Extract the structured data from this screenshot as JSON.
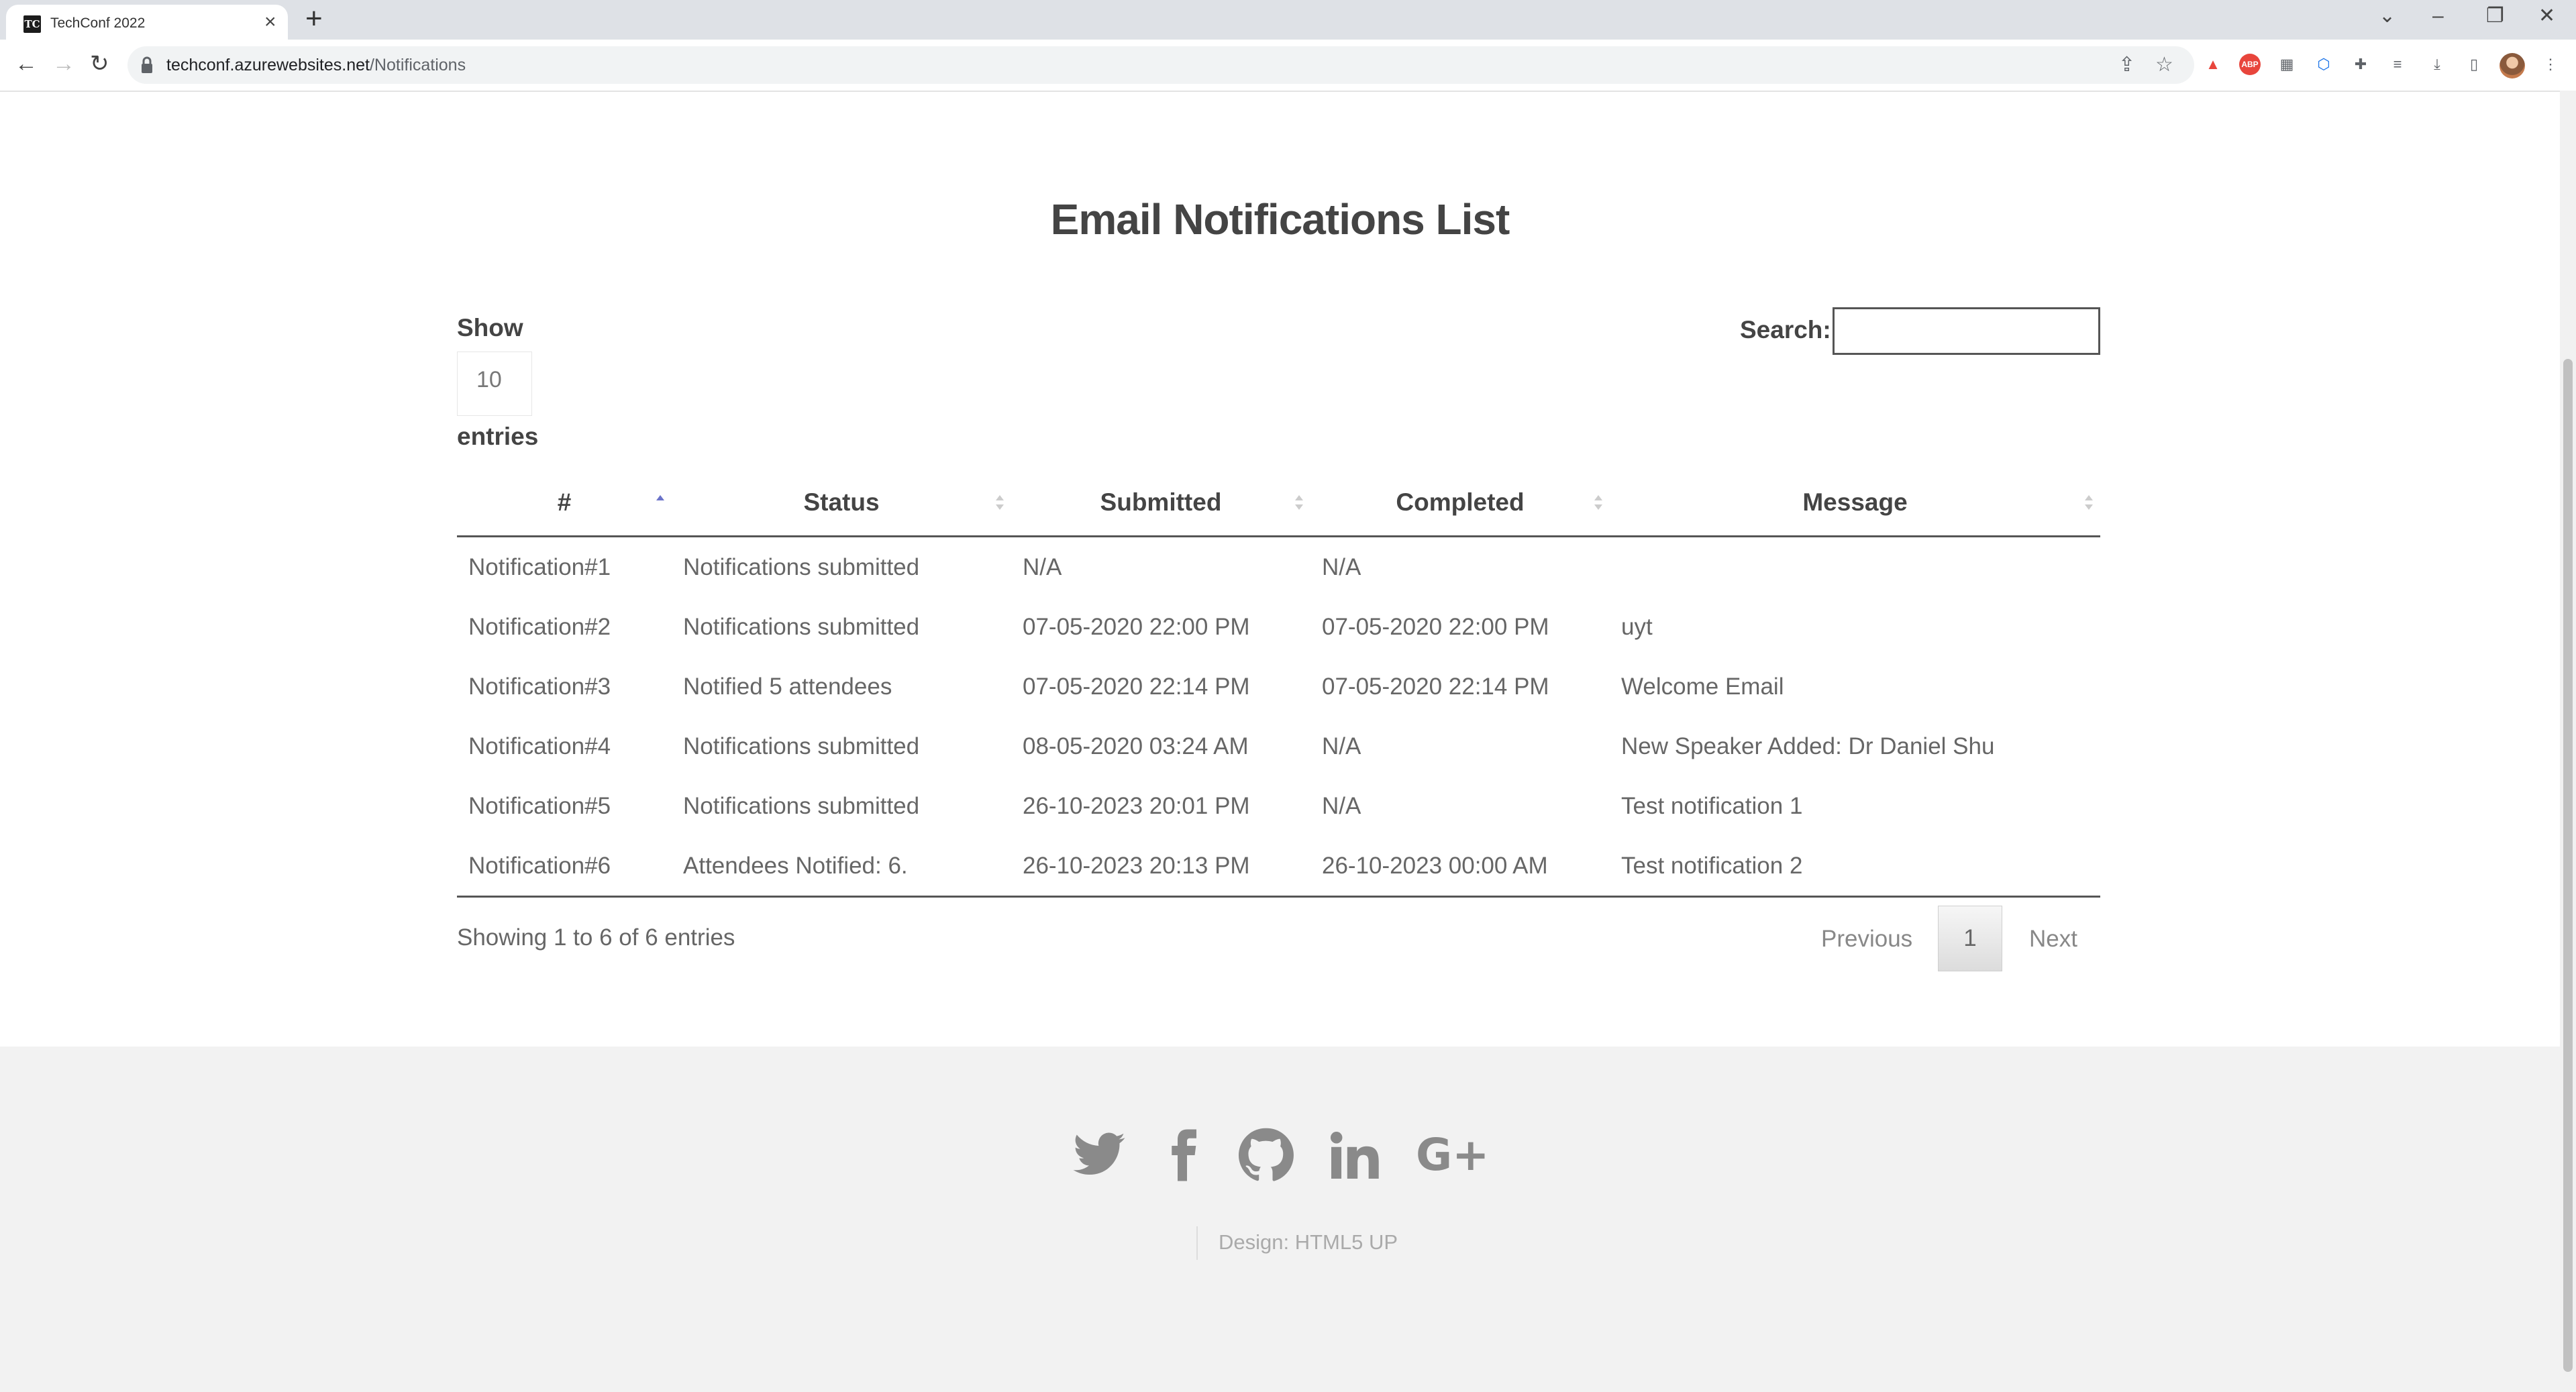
{
  "browser": {
    "tab_title": "TechConf 2022",
    "favicon_text": "TC",
    "url_host": "techconf.azurewebsites.net",
    "url_path": "/Notifications"
  },
  "page": {
    "title": "Email Notifications List"
  },
  "datatable": {
    "show_label": "Show",
    "length_value": "10",
    "entries_label": "entries",
    "search_label": "Search:",
    "search_value": "",
    "columns": [
      "#",
      "Status",
      "Submitted",
      "Completed",
      "Message"
    ],
    "sorted_column": "#",
    "sort_direction": "ascending",
    "rows": [
      {
        "id": "Notification#1",
        "status": "Notifications submitted",
        "submitted": "N/A",
        "completed": "N/A",
        "message": ""
      },
      {
        "id": "Notification#2",
        "status": "Notifications submitted",
        "submitted": "07-05-2020 22:00 PM",
        "completed": "07-05-2020 22:00 PM",
        "message": "uyt"
      },
      {
        "id": "Notification#3",
        "status": "Notified 5 attendees",
        "submitted": "07-05-2020 22:14 PM",
        "completed": "07-05-2020 22:14 PM",
        "message": "Welcome Email"
      },
      {
        "id": "Notification#4",
        "status": "Notifications submitted",
        "submitted": "08-05-2020 03:24 AM",
        "completed": "N/A",
        "message": "New Speaker Added: Dr Daniel Shu"
      },
      {
        "id": "Notification#5",
        "status": "Notifications submitted",
        "submitted": "26-10-2023 20:01 PM",
        "completed": "N/A",
        "message": "Test notification 1"
      },
      {
        "id": "Notification#6",
        "status": "Attendees Notified: 6.",
        "submitted": "26-10-2023 20:13 PM",
        "completed": "26-10-2023 00:00 AM",
        "message": "Test notification 2"
      }
    ],
    "info": "Showing 1 to 6 of 6 entries",
    "pagination": {
      "previous": "Previous",
      "current": "1",
      "next": "Next"
    }
  },
  "footer": {
    "social_icons": [
      "twitter-icon",
      "facebook-icon",
      "github-icon",
      "linkedin-icon",
      "google-plus-icon"
    ],
    "google_plus_text": "G+",
    "credit": "Design: HTML5 UP"
  },
  "colors": {
    "sort_active": "#6b73c9",
    "footer_bg": "#f2f2f2",
    "icon_gray": "#8a8a8a"
  }
}
